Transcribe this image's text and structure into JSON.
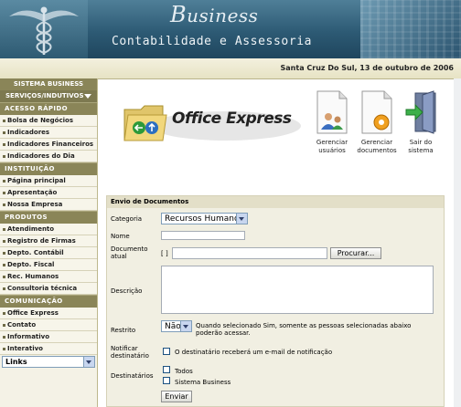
{
  "header": {
    "brand_initial": "B",
    "brand_rest": "usiness",
    "subtitle": "Contabilidade e Assessoria",
    "date": "Santa Cruz Do Sul, 13 de outubro de 2006"
  },
  "sidebar": {
    "system_label": "SISTEMA BUSINESS",
    "services_label": "SERVIÇOS/INDUTIVOS",
    "sections": [
      {
        "title": "ACESSO RÁPIDO",
        "items": [
          "Bolsa de Negócios",
          "Indicadores",
          "Indicadores Financeiros",
          "Indicadores do Dia"
        ]
      },
      {
        "title": "INSTITUIÇÃO",
        "items": [
          "Página principal",
          "Apresentação",
          "Nossa Empresa"
        ]
      },
      {
        "title": "PRODUTOS",
        "items": [
          "Atendimento",
          "Registro de Firmas",
          "Depto. Contábil",
          "Depto. Fiscal",
          "Rec. Humanos",
          "Consultoria técnica"
        ]
      },
      {
        "title": "COMUNICAÇÃO",
        "items": [
          "Office Express",
          "Contato",
          "Informativo",
          "Interativo"
        ]
      }
    ],
    "links_select": "Links"
  },
  "toolbar": {
    "logo_text": "Office Express",
    "manage_users": [
      "Gerenciar",
      "usuários"
    ],
    "manage_docs": [
      "Gerenciar",
      "documentos"
    ],
    "logout": [
      "Sair do",
      "sistema"
    ]
  },
  "form": {
    "title": "Envio de Documentos",
    "category_label": "Categoria",
    "category_value": "Recursos Humanos",
    "name_label": "Nome",
    "doc_label_1": "Documento",
    "doc_label_2": "atual",
    "doc_brackets": "[ ]",
    "browse_button": "Procurar...",
    "description_label": "Descrição",
    "restricted_label": "Restrito",
    "restricted_value": "Não",
    "restricted_note_1": "Quando selecionado Sim, somente as pessoas selecionadas abaixo",
    "restricted_note_2": "poderão acessar.",
    "notify_label_1": "Notificar",
    "notify_label_2": "destinatário",
    "notify_text": "O destinatário receberá um e-mail de notificação",
    "recipients_label": "Destinatários",
    "recipient_all": "Todos",
    "recipient_system": "Sistema Business",
    "submit_button": "Enviar"
  },
  "colors": {
    "header": "#2d5a74",
    "sidebar_heading": "#8a8558",
    "form_bg": "#f1efe2"
  }
}
